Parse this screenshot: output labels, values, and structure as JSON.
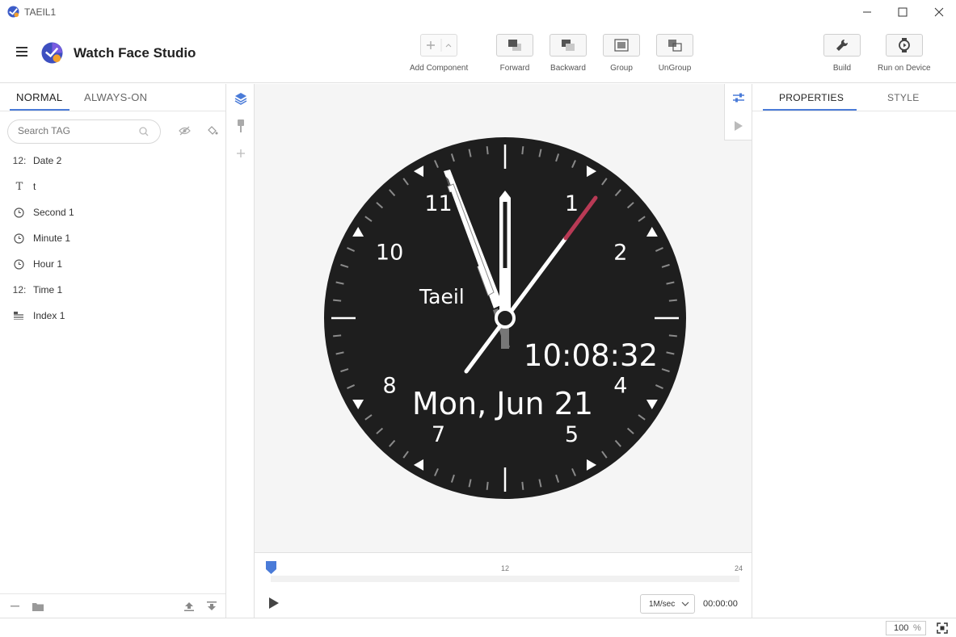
{
  "window": {
    "title": "TAEIL1"
  },
  "header": {
    "app_name": "Watch Face Studio",
    "tools": [
      {
        "label": "Add Component",
        "icon": "add-icon"
      },
      {
        "label": "Forward",
        "icon": "forward-icon"
      },
      {
        "label": "Backward",
        "icon": "backward-icon"
      },
      {
        "label": "Group",
        "icon": "group-icon"
      },
      {
        "label": "UnGroup",
        "icon": "ungroup-icon"
      },
      {
        "label": "Build",
        "icon": "wrench-icon"
      },
      {
        "label": "Run on Device",
        "icon": "watch-icon"
      }
    ]
  },
  "left": {
    "tabs": [
      "NORMAL",
      "ALWAYS-ON"
    ],
    "active_tab": "NORMAL",
    "search_placeholder": "Search TAG",
    "layers": [
      {
        "icon": "12:",
        "name": "Date 2"
      },
      {
        "icon": "T",
        "name": "t"
      },
      {
        "icon": "clock",
        "name": "Second 1"
      },
      {
        "icon": "clock",
        "name": "Minute 1"
      },
      {
        "icon": "clock",
        "name": "Hour 1"
      },
      {
        "icon": "12:",
        "name": "Time 1"
      },
      {
        "icon": "index",
        "name": "Index 1"
      }
    ]
  },
  "watch": {
    "brand": "Taeil",
    "digital_time": "10:08:32",
    "date": "Mon, Jun 21",
    "numerals": [
      "1",
      "2",
      "4",
      "5",
      "7",
      "8",
      "10",
      "11"
    ],
    "colors": {
      "face": "#1e1e1e",
      "second_accent": "#b83a55",
      "marks": "#ffffff"
    }
  },
  "timeline": {
    "ticks": [
      "12",
      "24"
    ],
    "speed": "1M/sec",
    "time": "00:00:00"
  },
  "right": {
    "tabs": [
      "PROPERTIES",
      "STYLE"
    ],
    "active_tab": "PROPERTIES"
  },
  "status": {
    "zoom_value": "100",
    "zoom_unit": "%"
  },
  "accent": "#4a7bd8"
}
